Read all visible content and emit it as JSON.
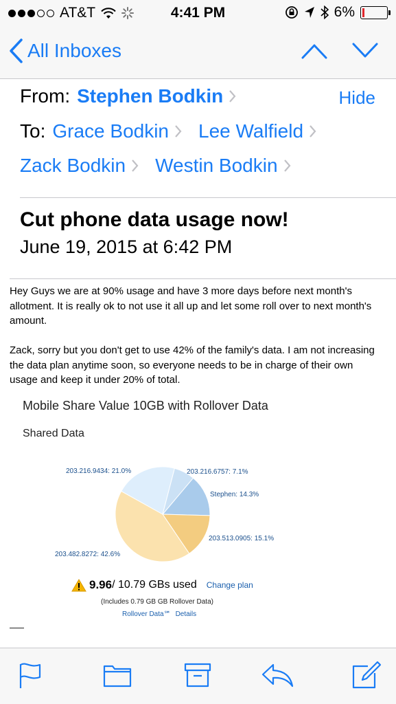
{
  "status_bar": {
    "carrier": "AT&T",
    "time": "4:41 PM",
    "battery": "6%",
    "battery_level": 0.06,
    "signal_bars_filled": 3,
    "signal_bars_total": 5
  },
  "nav": {
    "back_label": "All Inboxes",
    "accent_color": "#1a7cf5"
  },
  "header": {
    "from_label": "From:",
    "from_name": "Stephen Bodkin",
    "hide_label": "Hide",
    "to_label": "To:",
    "recipients": [
      "Grace Bodkin",
      "Lee Walfield",
      "Zack Bodkin",
      "Westin Bodkin"
    ]
  },
  "message": {
    "subject": "Cut phone data usage now!",
    "date": "June 19, 2015 at 6:42 PM",
    "paragraphs": [
      "Hey Guys we are at 90% usage and have 3 more days before next month's allotment. It is really ok to not use it all up and let some roll over to next month's amount.",
      "Zack, sorry but you don't get to use 42% of the family's data. I am not increasing the data plan anytime soon, so everyone needs to be in charge of their own usage and keep it under 20% of total."
    ]
  },
  "plan": {
    "title": "Mobile Share Value 10GB with Rollover Data",
    "subtitle": "Shared Data",
    "used": "9.96",
    "total_text": " / 10.79 GBs used",
    "change_plan": "Change plan",
    "includes": "(Includes 0.79 GB GB Rollover Data)",
    "rollover_label": "Rollover Data℠",
    "details_label": "Details"
  },
  "chart_data": {
    "type": "pie",
    "slices": [
      {
        "label": "Stephen: 14.3%",
        "value": 14.3,
        "color": "#a9cbeb"
      },
      {
        "label": "203.513.0905: 15.1%",
        "value": 15.1,
        "color": "#f3cc80"
      },
      {
        "label": "203.482.8272: 42.6%",
        "value": 42.6,
        "color": "#fbe2ae"
      },
      {
        "label": "203.216.9434: 21.0%",
        "value": 21.0,
        "color": "#deeefc"
      },
      {
        "label": "203.216.6757: 7.1%",
        "value": 7.1,
        "color": "#cbe1f5"
      }
    ]
  },
  "toolbar": {
    "icons": [
      "flag-icon",
      "folder-icon",
      "archive-icon",
      "reply-icon",
      "compose-icon"
    ],
    "icon_color": "#1a7cf5"
  }
}
